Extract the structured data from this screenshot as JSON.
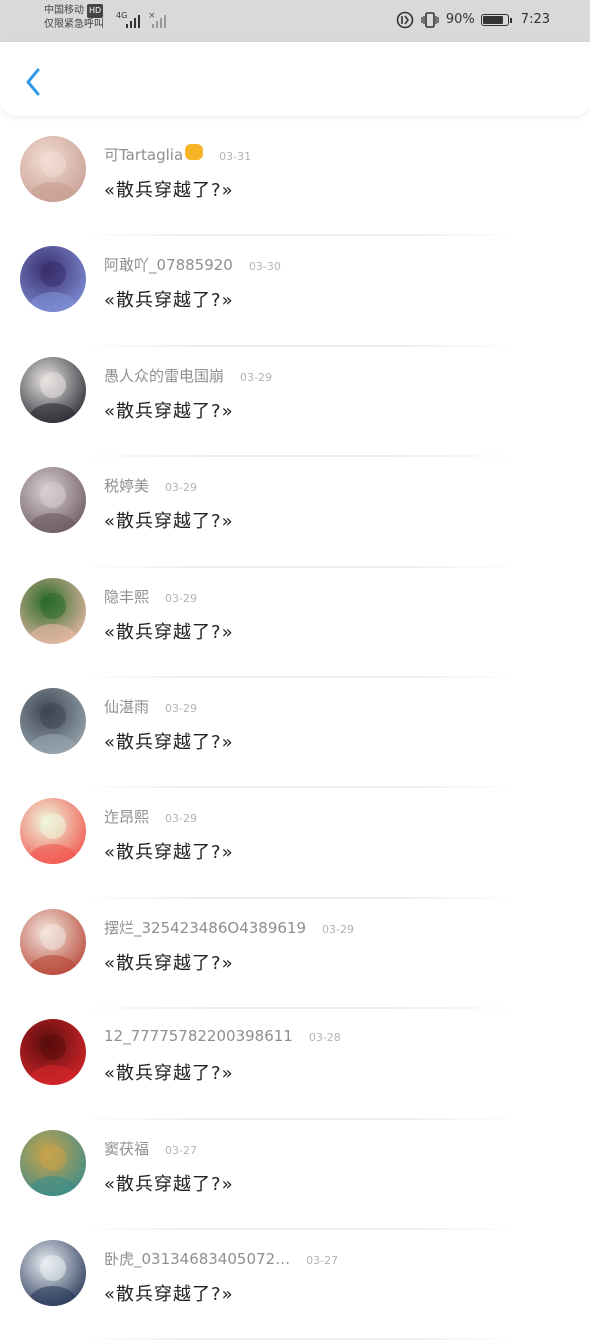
{
  "status_bar": {
    "carrier_line1": "中国移动",
    "carrier_badge": "HD",
    "carrier_line2": "仅限紧急呼叫",
    "network": "4G",
    "battery_percent": "90%",
    "battery_level": 0.9,
    "time": "7:23"
  },
  "header": {
    "back_icon": "chevron-left-icon",
    "accent": "#2f9be8"
  },
  "comments": [
    {
      "name": "可Tartaglia",
      "emoji": "fist-emoji",
      "date": "03-31",
      "text": "«散兵穿越了?»",
      "avatar_colors": [
        "#f2dcd3",
        "#c89f93"
      ]
    },
    {
      "name": "阿敢吖_07885920",
      "emoji": "",
      "date": "03-30",
      "text": "«散兵穿越了?»",
      "avatar_colors": [
        "#3b2f6e",
        "#7f8fd6"
      ]
    },
    {
      "name": "愚人众的雷电国崩",
      "emoji": "",
      "date": "03-29",
      "text": "«散兵穿越了?»",
      "avatar_colors": [
        "#e8e4e2",
        "#2b2b33"
      ]
    },
    {
      "name": "税婷美",
      "emoji": "",
      "date": "03-29",
      "text": "«散兵穿越了?»",
      "avatar_colors": [
        "#d9cfd0",
        "#6d5b64"
      ]
    },
    {
      "name": "隐丰熙",
      "emoji": "",
      "date": "03-29",
      "text": "«散兵穿越了?»",
      "avatar_colors": [
        "#2c6b2a",
        "#e7b9a5"
      ]
    },
    {
      "name": "仙湛雨",
      "emoji": "",
      "date": "03-29",
      "text": "«散兵穿越了?»",
      "avatar_colors": [
        "#3d4752",
        "#9aa7b0"
      ]
    },
    {
      "name": "迮昂熙",
      "emoji": "",
      "date": "03-29",
      "text": "«散兵穿越了?»",
      "avatar_colors": [
        "#eef7dd",
        "#f2564f"
      ]
    },
    {
      "name": "摆烂_325423486O4389619",
      "emoji": "",
      "date": "03-29",
      "text": "«散兵穿越了?»",
      "avatar_colors": [
        "#f3e6de",
        "#b94a3b"
      ]
    },
    {
      "name": "12_77775782200398611",
      "emoji": "",
      "date": "03-28",
      "text": "«散兵穿越了?»",
      "avatar_colors": [
        "#5a0d0d",
        "#d6262a"
      ]
    },
    {
      "name": "窦茯福",
      "emoji": "",
      "date": "03-27",
      "text": "«散兵穿越了?»",
      "avatar_colors": [
        "#c9a34a",
        "#3c8c8a"
      ]
    },
    {
      "name": "卧虎_03134683405072…",
      "emoji": "",
      "date": "03-27",
      "text": "«散兵穿越了?»",
      "avatar_colors": [
        "#e9eef2",
        "#2a3a5a"
      ]
    }
  ]
}
